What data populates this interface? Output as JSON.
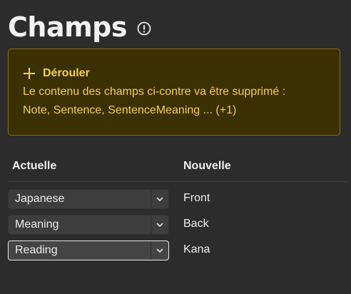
{
  "header": {
    "title": "Champs",
    "info_icon": "info-circle-icon"
  },
  "warning": {
    "expand_label": "Dérouler",
    "expand_icon": "plus-icon",
    "line1": "Le contenu des champs ci-contre va être supprimé :",
    "line2": "Note, Sentence, SentenceMeaning ... (+1)",
    "colors": {
      "background": "#3b3000",
      "border": "#8a6c0e",
      "text": "#f5cf55"
    }
  },
  "table": {
    "col_current": "Actuelle",
    "col_new": "Nouvelle",
    "rows": [
      {
        "current": "Japanese",
        "new": "Front"
      },
      {
        "current": "Meaning",
        "new": "Back"
      },
      {
        "current": "Reading",
        "new": "Kana"
      }
    ]
  },
  "colors": {
    "background": "#2c2c2c",
    "select_background": "#3d3d3d",
    "focus_border": "#e6e6e6"
  }
}
